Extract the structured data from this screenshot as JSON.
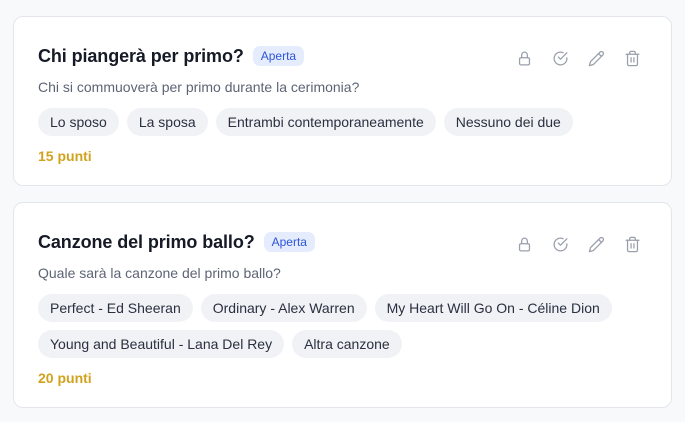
{
  "questions": [
    {
      "title": "Chi piangerà per primo?",
      "status": "Aperta",
      "description": "Chi si commuoverà per primo durante la cerimonia?",
      "options": [
        "Lo sposo",
        "La sposa",
        "Entrambi contemporaneamente",
        "Nessuno dei due"
      ],
      "points": "15 punti",
      "actions": [
        "lock-icon",
        "check-circle-icon",
        "pencil-icon",
        "trash-icon"
      ]
    },
    {
      "title": "Canzone del primo ballo?",
      "status": "Aperta",
      "description": "Quale sarà la canzone del primo ballo?",
      "options": [
        "Perfect - Ed Sheeran",
        "Ordinary - Alex Warren",
        "My Heart Will Go On - Céline Dion",
        "Young and Beautiful - Lana Del Rey",
        "Altra canzone"
      ],
      "points": "20 punti",
      "actions": [
        "lock-icon",
        "check-circle-icon",
        "pencil-icon",
        "trash-icon"
      ]
    }
  ],
  "colors": {
    "badge_bg": "#e5ecfd",
    "badge_text": "#2d55d6",
    "points": "#d1a21d",
    "chip_bg": "#f0f2f5",
    "icon": "#9aa0ab"
  }
}
